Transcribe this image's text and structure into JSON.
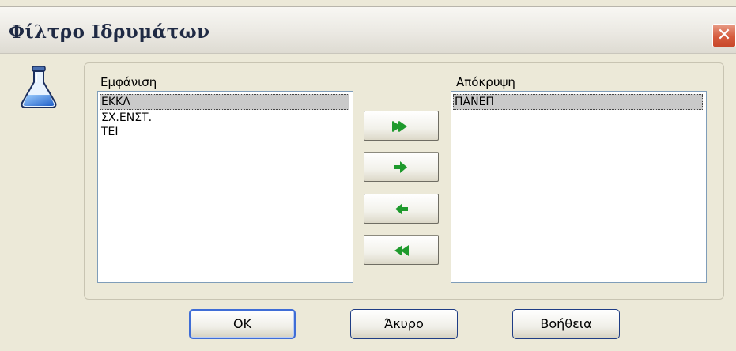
{
  "window": {
    "title": "Φίλτρο Ιδρυμάτων",
    "close_glyph": "✕"
  },
  "show_list": {
    "label": "Εμφάνιση",
    "items": [
      {
        "label": "ΕΚΚΛ",
        "selected": true
      },
      {
        "label": "ΣΧ.ΕΝΣΤ.",
        "selected": false
      },
      {
        "label": "ΤΕΙ",
        "selected": false
      }
    ]
  },
  "hide_list": {
    "label": "Απόκρυψη",
    "items": [
      {
        "label": "ΠΑΝΕΠ",
        "selected": true
      }
    ]
  },
  "move_buttons": [
    {
      "icon": "double-arrow-right-icon"
    },
    {
      "icon": "arrow-right-icon"
    },
    {
      "icon": "arrow-left-icon"
    },
    {
      "icon": "double-arrow-left-icon"
    }
  ],
  "buttons": {
    "ok": "OK",
    "cancel": "Άκυρο",
    "help": "Βοήθεια"
  },
  "colors": {
    "arrow": "#1e9a2c",
    "selection": "#c9c9c9",
    "title_text": "#1f2a44"
  }
}
